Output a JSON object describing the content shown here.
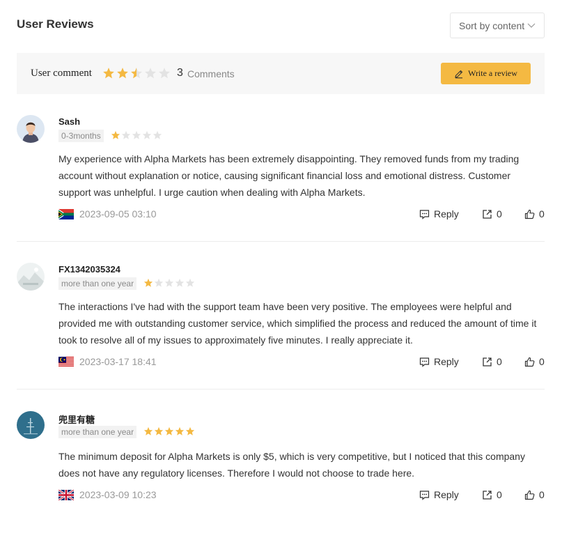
{
  "header": {
    "title": "User Reviews",
    "sort_label": "Sort by content"
  },
  "summary": {
    "label": "User comment",
    "rating": 2.5,
    "count": "3",
    "count_label": "Comments",
    "write_label": "Write a review"
  },
  "colors": {
    "accent": "#f4b942",
    "star_on": "#f4b942",
    "star_off": "#e3e3e3"
  },
  "reviews": [
    {
      "name": "Sash",
      "tag": "0-3months",
      "rating": 1,
      "text": "My experience with Alpha Markets has been extremely disappointing. They removed funds from my trading account without explanation or notice, causing significant financial loss and emotional distress. Customer support was unhelpful. I urge caution when dealing with Alpha Markets.",
      "flag": "south-africa",
      "date": "2023-09-05 03:10",
      "reply_label": "Reply",
      "shares": "0",
      "likes": "0"
    },
    {
      "name": "FX1342035324",
      "tag": "more than one year",
      "rating": 1,
      "text": "The interactions I've had with the support team have been very positive. The employees were helpful and provided me with outstanding customer service, which simplified the process and reduced the amount of time it took to resolve all of my issues to approximately five minutes. I really appreciate it.",
      "flag": "malaysia",
      "date": "2023-03-17 18:41",
      "reply_label": "Reply",
      "shares": "0",
      "likes": "0"
    },
    {
      "name": "兜里有糖",
      "tag": "more than one year",
      "rating": 5,
      "text": "The minimum deposit for Alpha Markets is only $5, which is very competitive, but I noticed that this company does not have any regulatory licenses. Therefore I would not choose to trade here.",
      "flag": "united-kingdom",
      "date": "2023-03-09 10:23",
      "reply_label": "Reply",
      "shares": "0",
      "likes": "0"
    }
  ]
}
